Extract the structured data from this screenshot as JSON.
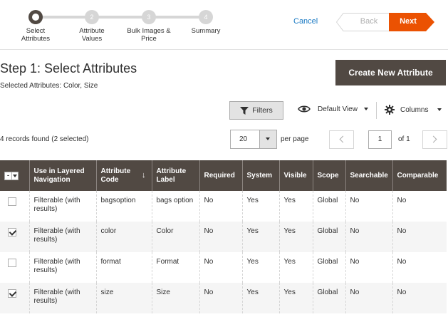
{
  "wizard": {
    "steps": [
      {
        "num": "",
        "label_line1": "Select",
        "label_line2": "Attributes"
      },
      {
        "num": "2",
        "label_line1": "Attribute",
        "label_line2": "Values"
      },
      {
        "num": "3",
        "label_line1": "Bulk Images &",
        "label_line2": "Price"
      },
      {
        "num": "4",
        "label_line1": "Summary",
        "label_line2": ""
      }
    ],
    "cancel_label": "Cancel",
    "back_label": "Back",
    "next_label": "Next"
  },
  "page": {
    "title": "Step 1: Select Attributes",
    "selected_attributes": "Selected Attributes: Color, Size",
    "create_button": "Create New Attribute"
  },
  "toolbar": {
    "filters_label": "Filters",
    "view_label": "Default View",
    "columns_label": "Columns",
    "records_text": "4 records found (2 selected)",
    "per_page_value": "20",
    "per_page_label": "per page",
    "current_page": "1",
    "of_pages": "of 1"
  },
  "grid": {
    "headers": {
      "layered": "Use in Layered Navigation",
      "code": "Attribute Code",
      "label": "Attribute Label",
      "required": "Required",
      "system": "System",
      "visible": "Visible",
      "scope": "Scope",
      "searchable": "Searchable",
      "comparable": "Comparable"
    },
    "mass_select_symbol": "-",
    "sort_arrow": "↓",
    "rows": [
      {
        "checked": false,
        "layered": "Filterable (with results)",
        "code": "bagsoption",
        "label": "bags option",
        "required": "No",
        "system": "Yes",
        "visible": "Yes",
        "scope": "Global",
        "searchable": "No",
        "comparable": "No"
      },
      {
        "checked": true,
        "layered": "Filterable (with results)",
        "code": "color",
        "label": "Color",
        "required": "No",
        "system": "Yes",
        "visible": "Yes",
        "scope": "Global",
        "searchable": "No",
        "comparable": "No"
      },
      {
        "checked": false,
        "layered": "Filterable (with results)",
        "code": "format",
        "label": "Format",
        "required": "No",
        "system": "Yes",
        "visible": "Yes",
        "scope": "Global",
        "searchable": "No",
        "comparable": "No"
      },
      {
        "checked": true,
        "layered": "Filterable (with results)",
        "code": "size",
        "label": "Size",
        "required": "No",
        "system": "Yes",
        "visible": "Yes",
        "scope": "Global",
        "searchable": "No",
        "comparable": "No"
      }
    ]
  },
  "colors": {
    "accent": "#eb5202",
    "header_dark": "#514943",
    "link": "#1979c3"
  }
}
